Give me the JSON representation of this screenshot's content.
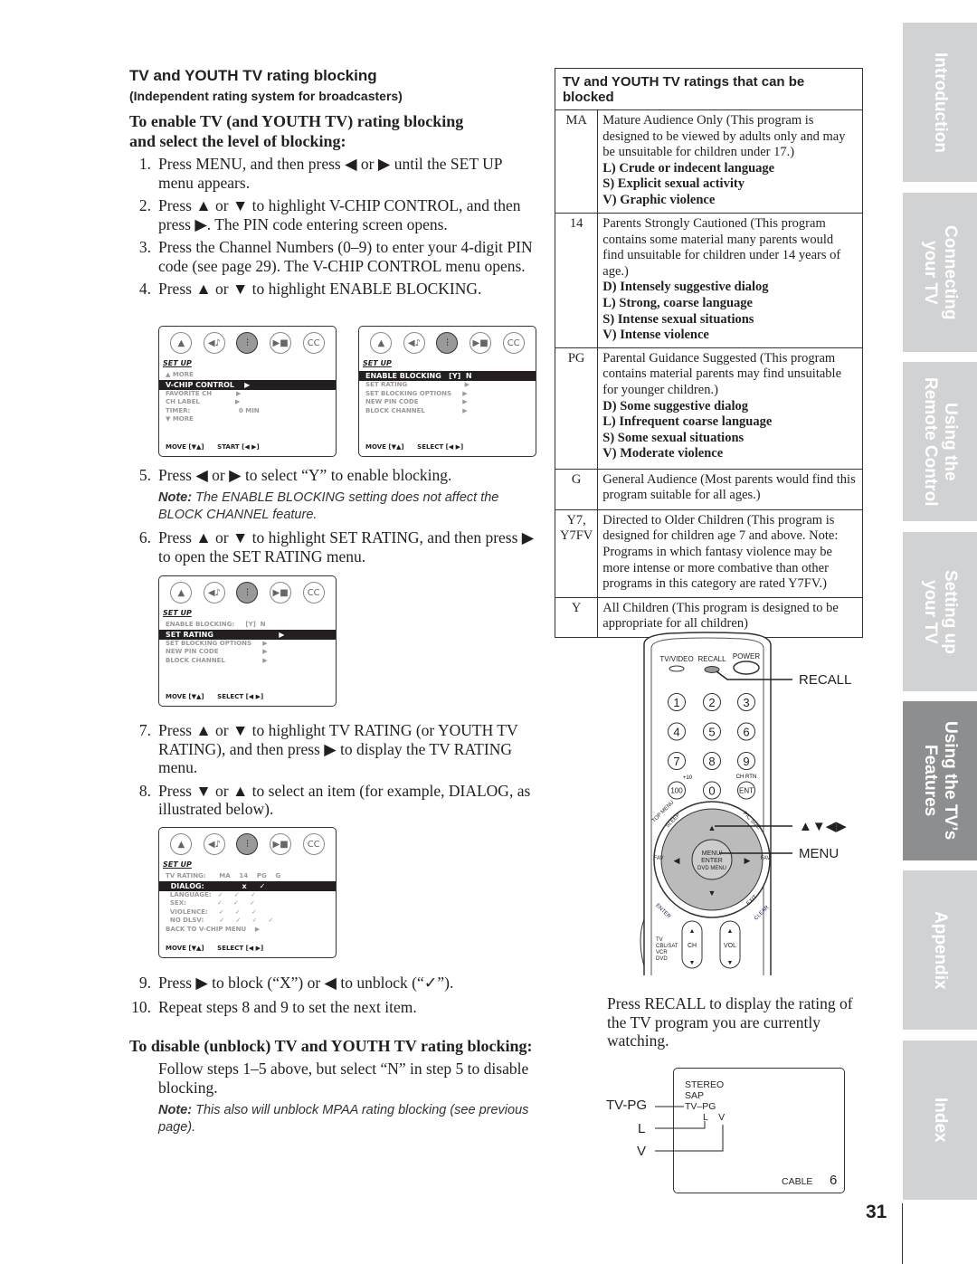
{
  "left": {
    "title": "TV and YOUTH TV rating blocking",
    "subtitle": "(Independent rating system for broadcasters)",
    "enable_heading": [
      "To enable TV (and YOUTH TV) rating blocking",
      "and select the level of blocking:"
    ],
    "steps_a": [
      {
        "n": "1.",
        "text": "Press MENU, and then press ◀ or ▶ until the SET UP menu appears."
      },
      {
        "n": "2.",
        "text": "Press ▲ or ▼ to highlight V-CHIP CONTROL, and then press ▶. The PIN code entering screen opens."
      },
      {
        "n": "3.",
        "text": "Press the Channel Numbers (0–9) to enter your 4-digit PIN code (see page 29). The V-CHIP CONTROL menu opens."
      },
      {
        "n": "4.",
        "text": "Press ▲ or ▼ to highlight ENABLE BLOCKING."
      }
    ],
    "steps_b": [
      {
        "n": "5.",
        "text": "Press ◀ or ▶ to select “Y” to enable blocking."
      }
    ],
    "note1": {
      "label": "Note:",
      "text": " The ENABLE BLOCKING setting does not affect the BLOCK CHANNEL feature."
    },
    "steps_c": [
      {
        "n": "6.",
        "text": "Press ▲ or ▼ to highlight SET RATING, and then press ▶ to open the SET RATING menu."
      }
    ],
    "steps_d": [
      {
        "n": "7.",
        "text": "Press ▲ or ▼ to highlight TV RATING (or YOUTH TV RATING), and then press ▶ to display the TV RATING menu."
      },
      {
        "n": "8.",
        "text": "Press ▼ or ▲ to select an item (for example, DIALOG, as illustrated below)."
      }
    ],
    "steps_e": [
      {
        "n": "9.",
        "text": "Press ▶ to block (“X”) or ◀ to unblock (“✓”)."
      },
      {
        "n": "10.",
        "text": "Repeat steps 8 and 9 to set the next item."
      }
    ],
    "disable_heading": "To disable (unblock) TV and YOUTH TV rating blocking:",
    "disable_text": "Follow steps 1–5 above, but select “N” in step 5 to disable blocking.",
    "note2": {
      "label": "Note:",
      "text": " This also will unblock MPAA rating blocking (see previous page)."
    }
  },
  "screens": [
    {
      "title": "SET UP",
      "items": [
        {
          "text": "▲ MORE",
          "hl": false
        },
        {
          "text": "V-CHIP CONTROL    ▶",
          "hl": true
        },
        {
          "text": "FAVORITE CH           ▶",
          "hl": false
        },
        {
          "text": "CH LABEL                ▶",
          "hl": false
        },
        {
          "text": "TIMER:                      0 MIN",
          "hl": false
        },
        {
          "text": "▼ MORE",
          "hl": false
        }
      ],
      "footer": "MOVE [▼▲]      START [◀ ▶]"
    },
    {
      "title": "SET UP",
      "items": [
        {
          "text": "ENABLE BLOCKING   [Y]  N",
          "hl": true
        },
        {
          "text": "SET RATING                          ▶",
          "hl": false
        },
        {
          "text": "SET BLOCKING OPTIONS     ▶",
          "hl": false
        },
        {
          "text": "NEW PIN CODE                    ▶",
          "hl": false
        },
        {
          "text": "BLOCK CHANNEL                 ▶",
          "hl": false
        }
      ],
      "footer": "MOVE [▼▲]      SELECT [◀ ▶]"
    },
    {
      "title": "SET UP",
      "items": [
        {
          "text": "ENABLE BLOCKING:     [Y]  N",
          "hl": false
        },
        {
          "text": "SET RATING                          ▶",
          "hl": true
        },
        {
          "text": "SET BLOCKING OPTIONS     ▶",
          "hl": false
        },
        {
          "text": "NEW PIN CODE                    ▶",
          "hl": false
        },
        {
          "text": "BLOCK CHANNEL                 ▶",
          "hl": false
        }
      ],
      "footer": "MOVE [▼▲]      SELECT [◀ ▶]"
    },
    {
      "title": "SET UP",
      "items": [
        {
          "text": "TV RATING:      MA    14    PG    G",
          "hl": false
        },
        {
          "text": "  DIALOG:               x     ✓",
          "hl": true
        },
        {
          "text": "  LANGUAGE:   ✓     ✓     ✓",
          "hl": false
        },
        {
          "text": "  SEX:              ✓     ✓     ✓",
          "hl": false
        },
        {
          "text": "  VIOLENCE:     ✓     ✓     ✓",
          "hl": false
        },
        {
          "text": "  NO DLSV:       ✓     ✓     ✓     ✓",
          "hl": false
        },
        {
          "text": "BACK TO V-CHIP MENU    ▶",
          "hl": false
        }
      ],
      "footer": "MOVE [▼▲]      SELECT [◀ ▶]"
    }
  ],
  "screen_icons": [
    "picture-icon",
    "audio-icon",
    "setup-icon",
    "theater-icon",
    "cc-icon"
  ],
  "cc_label": "CC",
  "ratings_table": {
    "header": "TV and YOUTH TV ratings that can be blocked",
    "rows": [
      {
        "code": "MA",
        "desc": "Mature Audience Only (This program is designed to be viewed by adults only and may be unsuitable for children under 17.)",
        "items": [
          "L) Crude or indecent language",
          "S) Explicit sexual activity",
          "V) Graphic violence"
        ]
      },
      {
        "code": "14",
        "desc": "Parents Strongly Cautioned (This program contains some material many parents would find unsuitable for children under 14 years of age.)",
        "items": [
          "D) Intensely suggestive dialog",
          "L) Strong, coarse language",
          "S) Intense sexual situations",
          "V) Intense violence"
        ]
      },
      {
        "code": "PG",
        "desc": "Parental Guidance Suggested (This program contains material parents may find unsuitable for younger children.)",
        "items": [
          "D) Some suggestive dialog",
          "L) Infrequent coarse language",
          "S) Some sexual situations",
          "V) Moderate violence"
        ]
      },
      {
        "code": "G",
        "desc": "General Audience (Most parents would find this program suitable for all ages.)",
        "items": []
      },
      {
        "code": "Y7, Y7FV",
        "desc": "Directed to Older Children (This program is designed for children age 7 and above. Note: Programs in which fantasy violence may be more intense or more combative than other programs in this category are rated Y7FV.)",
        "items": []
      },
      {
        "code": "Y",
        "desc": "All Children (This program is designed to be appropriate for all children)",
        "items": []
      }
    ]
  },
  "remote": {
    "top_labels": [
      "TV/VIDEO",
      "RECALL",
      "POWER"
    ],
    "digits": [
      "1",
      "2",
      "3",
      "4",
      "5",
      "6",
      "7",
      "8",
      "9",
      "100",
      "0",
      "ENT"
    ],
    "plus10": "+10",
    "chrtn": "CH RTN",
    "topmenu": "TOP MENU",
    "sleep": "SLEEP",
    "picsize": "PIC SIZE",
    "center": [
      "MENU/",
      "ENTER",
      "DVD MENU"
    ],
    "fav": "FAV",
    "enter": "ENTER",
    "exit": "EXIT",
    "clear": "CLEAR",
    "ch": "CH",
    "vol": "VOL",
    "modes": [
      "TV",
      "CBL/SAT",
      "VCR",
      "DVD"
    ],
    "callouts": {
      "recall": "RECALL",
      "arrows": "▲▼◀▶",
      "menu": "MENU"
    }
  },
  "recall_text": "Press RECALL to display the rating of the TV program you are currently watching.",
  "osd": {
    "lines": [
      "STEREO",
      "SAP",
      "TV–PG"
    ],
    "sub": [
      "L",
      "V"
    ],
    "source": "CABLE",
    "channel": "6",
    "callouts": [
      "TV-PG",
      "L",
      "V"
    ]
  },
  "side_tabs": [
    {
      "label": "Introduction",
      "active": false
    },
    {
      "label": "Connecting\nyour TV",
      "active": false
    },
    {
      "label": "Using the\nRemote Control",
      "active": false
    },
    {
      "label": "Setting up\nyour TV",
      "active": false
    },
    {
      "label": "Using the TV’s\nFeatures",
      "active": true
    },
    {
      "label": "Appendix",
      "active": false
    },
    {
      "label": "Index",
      "active": false
    }
  ],
  "page_number": "31"
}
